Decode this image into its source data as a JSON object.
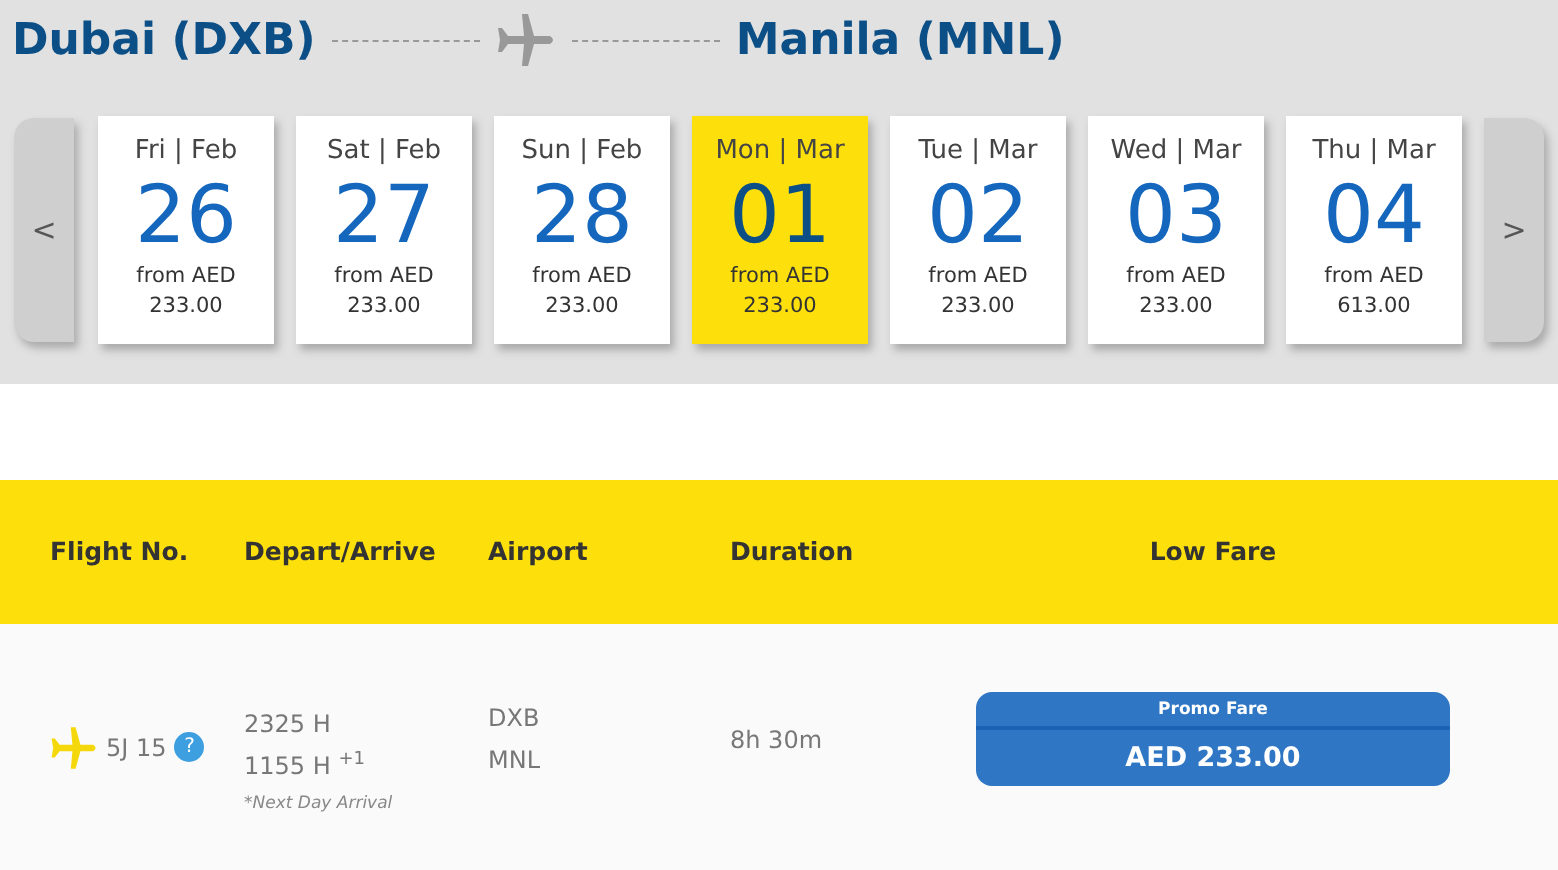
{
  "route": {
    "origin": "Dubai (DXB)",
    "destination": "Manila (MNL)"
  },
  "date_nav": {
    "prev": "<",
    "next": ">"
  },
  "dates": [
    {
      "day": "Fri | Feb",
      "date": "26",
      "from": "from AED",
      "price": "233.00",
      "selected": false
    },
    {
      "day": "Sat | Feb",
      "date": "27",
      "from": "from AED",
      "price": "233.00",
      "selected": false
    },
    {
      "day": "Sun | Feb",
      "date": "28",
      "from": "from AED",
      "price": "233.00",
      "selected": false
    },
    {
      "day": "Mon | Mar",
      "date": "01",
      "from": "from AED",
      "price": "233.00",
      "selected": true
    },
    {
      "day": "Tue | Mar",
      "date": "02",
      "from": "from AED",
      "price": "233.00",
      "selected": false
    },
    {
      "day": "Wed | Mar",
      "date": "03",
      "from": "from AED",
      "price": "233.00",
      "selected": false
    },
    {
      "day": "Thu | Mar",
      "date": "04",
      "from": "from AED",
      "price": "613.00",
      "selected": false
    }
  ],
  "table": {
    "columns": [
      "Flight No.",
      "Depart/Arrive",
      "Airport",
      "Duration",
      "Low Fare"
    ],
    "rows": [
      {
        "flight": "5J 15",
        "help": "?",
        "depart": "2325 H",
        "arrive": "1155 H $^{+1}$",
        "note": "*Next Day Arrival",
        "airports": [
          "DXB",
          "MNL"
        ],
        "duration": "8h 30m",
        "fare_label": "Promo Fare",
        "fare": "AED 233.00"
      }
    ]
  }
}
